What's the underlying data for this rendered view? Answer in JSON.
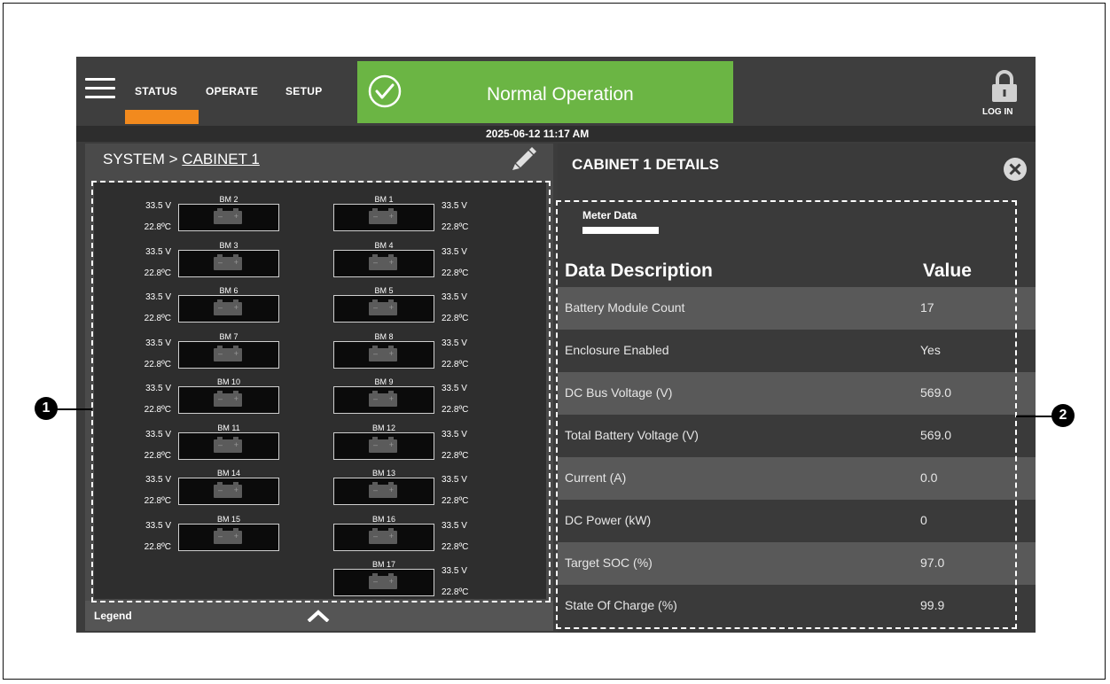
{
  "topbar": {
    "tabs": [
      {
        "label": "STATUS",
        "active": true
      },
      {
        "label": "OPERATE",
        "active": false
      },
      {
        "label": "SETUP",
        "active": false
      }
    ],
    "status": {
      "text": "Normal Operation",
      "color": "#6bb544"
    },
    "login_label": "LOG IN",
    "accent_color": "#f28a1e",
    "datetime": "2025-06-12 11:17 AM"
  },
  "left_panel": {
    "breadcrumb_root": "SYSTEM >",
    "breadcrumb_current": "CABINET 1",
    "modules_left": [
      {
        "name": "BM 2",
        "voltage": "33.5 V",
        "temp": "22.8ºC"
      },
      {
        "name": "BM 3",
        "voltage": "33.5 V",
        "temp": "22.8ºC"
      },
      {
        "name": "BM 6",
        "voltage": "33.5 V",
        "temp": "22.8ºC"
      },
      {
        "name": "BM 7",
        "voltage": "33.5 V",
        "temp": "22.8ºC"
      },
      {
        "name": "BM 10",
        "voltage": "33.5 V",
        "temp": "22.8ºC"
      },
      {
        "name": "BM 11",
        "voltage": "33.5 V",
        "temp": "22.8ºC"
      },
      {
        "name": "BM 14",
        "voltage": "33.5 V",
        "temp": "22.8ºC"
      },
      {
        "name": "BM 15",
        "voltage": "33.5 V",
        "temp": "22.8ºC"
      }
    ],
    "modules_right": [
      {
        "name": "BM 1",
        "voltage": "33.5 V",
        "temp": "22.8ºC"
      },
      {
        "name": "BM 4",
        "voltage": "33.5 V",
        "temp": "22.8ºC"
      },
      {
        "name": "BM 5",
        "voltage": "33.5 V",
        "temp": "22.8ºC"
      },
      {
        "name": "BM 8",
        "voltage": "33.5 V",
        "temp": "22.8ºC"
      },
      {
        "name": "BM 9",
        "voltage": "33.5 V",
        "temp": "22.8ºC"
      },
      {
        "name": "BM 12",
        "voltage": "33.5 V",
        "temp": "22.8ºC"
      },
      {
        "name": "BM 13",
        "voltage": "33.5 V",
        "temp": "22.8ºC"
      },
      {
        "name": "BM 16",
        "voltage": "33.5 V",
        "temp": "22.8ºC"
      },
      {
        "name": "BM 17",
        "voltage": "33.5 V",
        "temp": "22.8ºC"
      }
    ],
    "legend_label": "Legend"
  },
  "right_panel": {
    "title": "CABINET 1 DETAILS",
    "tab_label": "Meter Data",
    "columns": [
      "Data Description",
      "Value"
    ],
    "rows": [
      {
        "desc": "Battery Module Count",
        "value": "17"
      },
      {
        "desc": "Enclosure Enabled",
        "value": "Yes"
      },
      {
        "desc": "DC Bus Voltage (V)",
        "value": "569.0"
      },
      {
        "desc": "Total Battery Voltage (V)",
        "value": "569.0"
      },
      {
        "desc": "Current (A)",
        "value": "0.0"
      },
      {
        "desc": "DC Power (kW)",
        "value": "0"
      },
      {
        "desc": "Target SOC (%)",
        "value": "97.0"
      },
      {
        "desc": "State Of Charge (%)",
        "value": "99.9"
      }
    ]
  },
  "callouts": [
    "1",
    "2"
  ],
  "icons": [
    "menu-icon",
    "check-circle-icon",
    "lock-icon",
    "pencil-icon",
    "battery-icon",
    "caret-up-icon",
    "close-icon"
  ]
}
